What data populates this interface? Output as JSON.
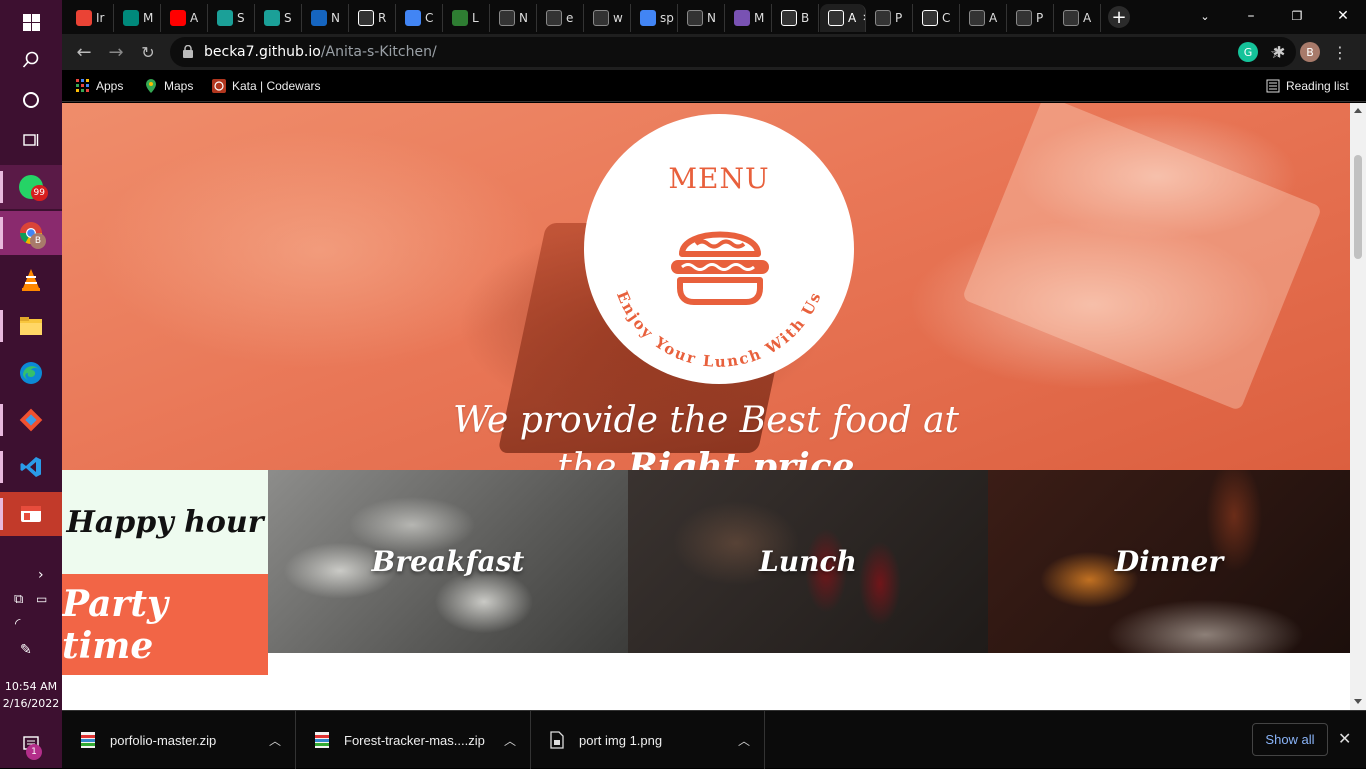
{
  "taskbar": {
    "whatsapp_badge": "99",
    "chrome_badge": "B",
    "notifications_badge": "1",
    "time": "10:54 AM",
    "date": "2/16/2022"
  },
  "tabs": [
    {
      "label": "Ir",
      "icon": "gmail-icon",
      "color": "#ea4335"
    },
    {
      "label": "M",
      "icon": "meet-icon",
      "color": "#00897b"
    },
    {
      "label": "A",
      "icon": "youtube-icon",
      "color": "#ff0000"
    },
    {
      "label": "S",
      "icon": "fs-icon",
      "color": "#1ba098"
    },
    {
      "label": "S",
      "icon": "fs-icon",
      "color": "#1ba098"
    },
    {
      "label": "N",
      "icon": "bookmark-icon",
      "color": "#1565c0"
    },
    {
      "label": "R",
      "icon": "target-icon",
      "color": "#ffffff"
    },
    {
      "label": "C",
      "icon": "color-wheel-icon",
      "color": "#4285f4"
    },
    {
      "label": "L",
      "icon": "w-icon",
      "color": "#2e7d32"
    },
    {
      "label": "N",
      "icon": "globe-icon",
      "color": "#888888"
    },
    {
      "label": "e",
      "icon": "globe-icon",
      "color": "#888888"
    },
    {
      "label": "w",
      "icon": "openai-icon",
      "color": "#888888"
    },
    {
      "label": "sp",
      "icon": "google-icon",
      "color": "#4285f4"
    },
    {
      "label": "N",
      "icon": "globe-icon",
      "color": "#888888"
    },
    {
      "label": "M",
      "icon": "b-icon",
      "color": "#7952b3"
    },
    {
      "label": "B",
      "icon": "github-icon",
      "color": "#ffffff"
    },
    {
      "label": "A",
      "icon": "a-icon",
      "color": "#ffffff",
      "active": true
    },
    {
      "label": "P",
      "icon": "globe-icon",
      "color": "#888888"
    },
    {
      "label": "C",
      "icon": "a-icon",
      "color": "#ffffff"
    },
    {
      "label": "A",
      "icon": "globe-icon",
      "color": "#888888"
    },
    {
      "label": "P",
      "icon": "globe-icon",
      "color": "#888888"
    },
    {
      "label": "A",
      "icon": "globe-icon",
      "color": "#888888"
    }
  ],
  "address": {
    "host": "becka7.github.io",
    "path": "/Anita-s-Kitchen/"
  },
  "profile_initial": "B",
  "bookmarks": {
    "apps": "Apps",
    "maps": "Maps",
    "codewars": "Kata | Codewars",
    "reading_list": "Reading list"
  },
  "page": {
    "logo_title": "MENU",
    "logo_tagline": "Enjoy Your Lunch With Us",
    "hero_line1": "We provide the Best food at",
    "hero_line2_a": "the ",
    "hero_line2_b": "Right price",
    "happy_hour": "Happy hour",
    "party_time": "Party time",
    "meals": [
      "Breakfast",
      "Lunch",
      "Dinner"
    ],
    "brand_color": "#e8603c"
  },
  "downloads": {
    "items": [
      "porfolio-master.zip",
      "Forest-tracker-mas....zip",
      "port img 1.png"
    ],
    "show_all": "Show all"
  }
}
